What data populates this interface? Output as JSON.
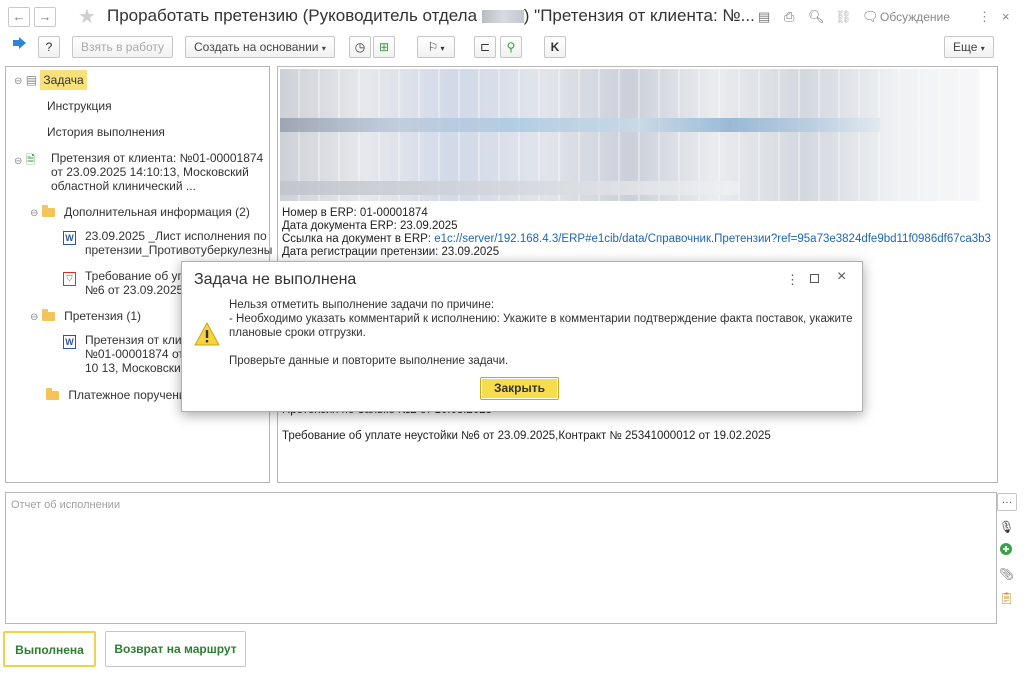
{
  "window": {
    "title_prefix": "Проработать претензию (Руководитель отдела",
    "title_suffix": ") \"Претензия от клиента:  №...",
    "discussion_label": "Обсуждение",
    "more_dots": "⋮"
  },
  "toolbar": {
    "take_to_work_label": "Взять в работу",
    "create_based_on_label": "Создать на основании",
    "more_label": "Еще"
  },
  "tree": {
    "task_label": "Задача",
    "instruction_label": "Инструкция",
    "history_label": "История выполнения",
    "claim_line1": "Претензия от клиента:  №01-00001874",
    "claim_line2": "от 23.09.2025 14:10:13, Московский",
    "claim_line3": "областной клинический ...",
    "extra_info_label": "Дополнительная информация (2)",
    "doc1_line1": "23.09.2025 _Лист исполнения по",
    "doc1_line2": "претензии_Противотуберкулезны",
    "doc2_line1": "Требование об упл",
    "doc2_line2": "№6 от 23.09.2025",
    "claims_folder_label": "Претензия (1)",
    "claim_doc_line1": "Претензия от клие",
    "claim_doc_line2": "№01-00001874 от",
    "claim_doc_line3": "10 13, Московский",
    "payment_label": "Платежное поручение"
  },
  "content": {
    "erp_number": "Номер в ERP: 01-00001874",
    "erp_date": "Дата документа ERP: 23.09.2025",
    "erp_link_label": "Ссылка на документ в ERP:",
    "erp_link_value": "e1c://server/192.168.4.3/ERP#e1cib/data/Справочник.Претензии?ref=95a73e3824dfe9bd11f0986df67ca3b3",
    "reg_date": "Дата регистрации претензии: 23.09.2025",
    "partial_line": "Претензия по Заявке №2 от 10.08.2025",
    "penalty_line": "Требование об уплате неустойки №6 от 23.09.2025,Контракт № 25341000012 от 19.02.2025"
  },
  "modal": {
    "title": "Задача не выполнена",
    "line1": "Нельзя отметить выполнение задачи по причине:",
    "line2": "- Необходимо указать комментарий к исполнению: Укажите в комментарии подтверждение факта поставок, укажите",
    "line3": "плановые сроки отгрузки.",
    "line4": "Проверьте данные и повторите выполнение задачи.",
    "close_label": "Закрыть"
  },
  "report": {
    "placeholder": "Отчет об исполнении"
  },
  "buttons": {
    "done_label": "Выполнена",
    "return_label": "Возврат на маршрут"
  },
  "colors": {
    "accent_yellow": "#f7dc4e",
    "link_blue": "#1d67b3",
    "action_green": "#2e7d32"
  }
}
